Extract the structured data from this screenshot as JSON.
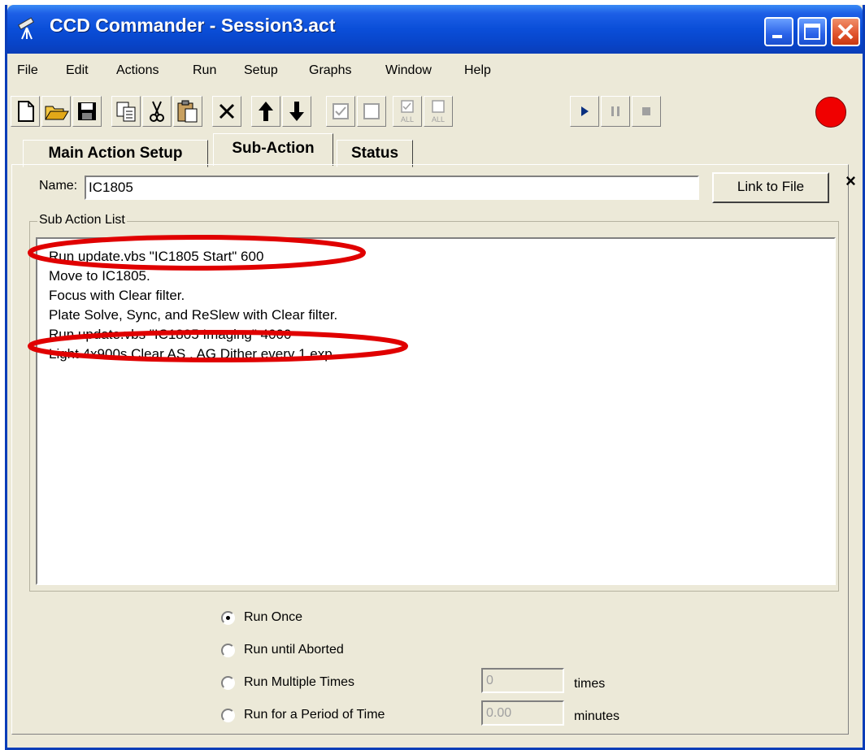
{
  "window": {
    "title": "CCD Commander - Session3.act"
  },
  "menu": [
    "File",
    "Edit",
    "Actions",
    "Run",
    "Setup",
    "Graphs",
    "Window",
    "Help"
  ],
  "toolbar": {
    "icons": [
      "new-file-icon",
      "open-folder-icon",
      "save-icon",
      "copy-icon",
      "cut-icon",
      "paste-icon",
      "delete-icon",
      "move-up-icon",
      "move-down-icon",
      "check-icon",
      "uncheck-icon",
      "check-all-icon",
      "uncheck-all-icon",
      "play-icon",
      "pause-icon",
      "stop-icon",
      "record-indicator-icon"
    ],
    "check_all_text": "ALL",
    "uncheck_all_text": "ALL"
  },
  "tabs": [
    {
      "label": "Main Action Setup",
      "active": false
    },
    {
      "label": "Sub-Action",
      "active": true
    },
    {
      "label": "Status",
      "active": false
    }
  ],
  "form": {
    "name_label": "Name:",
    "name_value": "IC1805",
    "link_button": "Link to File",
    "close_glyph": "×",
    "group_label": "Sub Action List"
  },
  "sub_actions": [
    "Run update.vbs \"IC1805 Start\" 600",
    "Move to IC1805.",
    "Focus with Clear filter.",
    "Plate Solve, Sync, and ReSlew with Clear filter.",
    "Run update.vbs \"IC1805 Imaging\" 4000",
    "Light 4x900s Clear AS   , AG Dither every 1 exp."
  ],
  "run_options": [
    {
      "label": "Run Once",
      "selected": true
    },
    {
      "label": "Run until Aborted",
      "selected": false
    },
    {
      "label": "Run Multiple Times",
      "selected": false
    },
    {
      "label": "Run for a Period of Time",
      "selected": false
    }
  ],
  "multiple_times": {
    "value": "0",
    "unit": "times"
  },
  "period": {
    "value": "0.00",
    "unit": "minutes"
  },
  "colors": {
    "title_blue": "#0a4ed8",
    "face": "#ece9d8",
    "annotation_red": "#e00000",
    "record": "#f00000"
  }
}
